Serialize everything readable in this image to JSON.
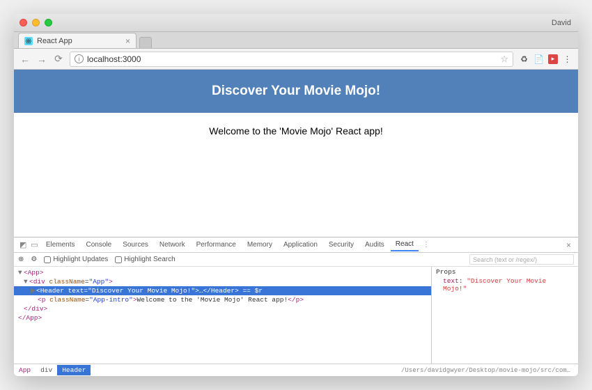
{
  "window": {
    "user": "David"
  },
  "tab": {
    "title": "React App"
  },
  "address": {
    "url": "localhost:3000"
  },
  "page": {
    "hero_title": "Discover Your Movie Mojo!",
    "intro_text": "Welcome to the 'Movie Mojo' React app!"
  },
  "devtools": {
    "tabs": [
      "Elements",
      "Console",
      "Sources",
      "Network",
      "Performance",
      "Memory",
      "Application",
      "Security",
      "Audits",
      "React"
    ],
    "active_tab": "React",
    "toolbar": {
      "highlight_updates": "Highlight Updates",
      "highlight_search": "Highlight Search",
      "search_placeholder": "Search (text or /regex/)"
    },
    "tree": {
      "l0": "<App>",
      "l1_open": "<div ",
      "l1_attr1n": "className",
      "l1_attr1v": "\"App\"",
      "l1_close": ">",
      "sel_open": "<Header ",
      "sel_attr_n": "text",
      "sel_attr_v": "\"Discover Your Movie Mojo!\"",
      "sel_mid": ">…</Header>",
      "sel_ref": " == $r",
      "l3_open": "<p ",
      "l3_attr_n": "className",
      "l3_attr_v": "\"App-intro\"",
      "l3_mid": ">",
      "l3_text": "Welcome to the 'Movie Mojo' React app!",
      "l3_close": "</p>",
      "l4": "</div>",
      "l5": "</App>"
    },
    "side": {
      "header": "Props",
      "prop_key": "text",
      "prop_val": "\"Discover Your Movie Mojo!\""
    },
    "crumbs": [
      "App",
      "div",
      "Header"
    ],
    "path": "/Users/davidgwyer/Desktop/movie-mojo/src/components/App.js"
  }
}
